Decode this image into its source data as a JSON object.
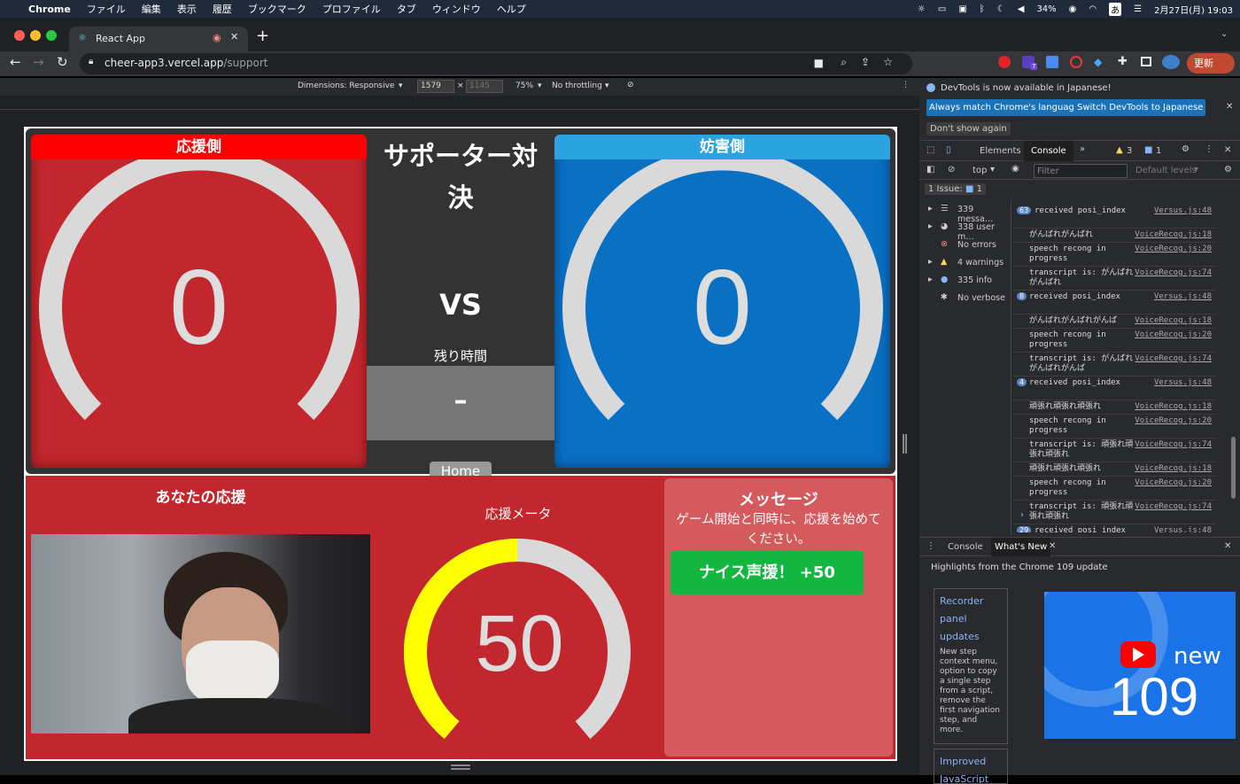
{
  "mac_menu": {
    "app": "Chrome",
    "items": [
      "ファイル",
      "編集",
      "表示",
      "履歴",
      "ブックマーク",
      "プロファイル",
      "タブ",
      "ウィンドウ",
      "ヘルプ"
    ],
    "battery": "34%",
    "ime": "あ",
    "datetime": "2月27日(月) 19:03"
  },
  "browser": {
    "tab_title": "React App",
    "url_host": "cheer-app3.vercel.app",
    "url_path": "/support",
    "update_label": "更新",
    "ext_badge": "7"
  },
  "device_toolbar": {
    "dimensions": "Dimensions: Responsive",
    "width": "1579",
    "height": "1145",
    "zoom": "75%",
    "throttling": "No throttling"
  },
  "page": {
    "cheer_side": "応援側",
    "disrupt_side": "妨害側",
    "title_line1": "サポーター対",
    "title_line2": "決",
    "vs": "VS",
    "remaining_label": "残り時間",
    "remaining_value": "–",
    "cheer_score": "0",
    "disrupt_score": "0",
    "home_button": "Home",
    "your_cheer": "あなたの応援",
    "meter_label": "応援メータ",
    "meter_value": "50",
    "meter_fraction": 0.5,
    "message_title": "メッセージ",
    "message_body": "ゲーム開始と同時に、応援を始めてください。",
    "nice_label": "ナイス声援！ +50",
    "colors": {
      "cheer": "#c1272d",
      "cheer_header": "#ff0000",
      "disrupt": "#0a70c4",
      "disrupt_header": "#2ba3e0",
      "meter_fill": "#ffff00",
      "nice_bg": "#13b63f"
    }
  },
  "devtools": {
    "notice": "DevTools is now available in Japanese!",
    "btn_match": "Always match Chrome's language",
    "btn_switch": "Switch DevTools to Japanese",
    "btn_dont": "Don't show again",
    "tab_elements": "Elements",
    "tab_console": "Console",
    "warn_count": "3",
    "msg_count": "1",
    "context": "top",
    "filter_placeholder": "Filter",
    "levels": "Default levels",
    "issues": "1 Issue:",
    "issues_count": "1",
    "sidebar": [
      {
        "label": "339 messa…",
        "icon": "list-icon"
      },
      {
        "label": "338 user m…",
        "icon": "user-icon"
      },
      {
        "label": "No errors",
        "icon": "error-icon"
      },
      {
        "label": "4 warnings",
        "icon": "warning-icon"
      },
      {
        "label": "335 info",
        "icon": "info-icon"
      },
      {
        "label": "No verbose",
        "icon": "verbose-icon"
      }
    ],
    "logs": [
      {
        "badge": "63",
        "text": "received posi_index",
        "src": "Versus.js:48"
      },
      {
        "badge": "",
        "text": "がんばれがんばれ",
        "src": "VoiceRecog.js:18"
      },
      {
        "badge": "",
        "text": "speech recong in progress",
        "src": "VoiceRecog.js:20"
      },
      {
        "badge": "",
        "text": "transcript is: がんばれがんばれ",
        "src": "VoiceRecog.js:74"
      },
      {
        "badge": "8",
        "text": "received posi_index",
        "src": "Versus.js:48"
      },
      {
        "badge": "",
        "text": "がんばれがんばれがんば",
        "src": "VoiceRecog.js:18"
      },
      {
        "badge": "",
        "text": "speech recong in progress",
        "src": "VoiceRecog.js:20"
      },
      {
        "badge": "",
        "text": "transcript is: がんばれがんばれがんば",
        "src": "VoiceRecog.js:74"
      },
      {
        "badge": "4",
        "text": "received posi_index",
        "src": "Versus.js:48"
      },
      {
        "badge": "",
        "text": "頑張れ頑張れ頑張れ",
        "src": "VoiceRecog.js:18"
      },
      {
        "badge": "",
        "text": "speech recong in progress",
        "src": "VoiceRecog.js:20"
      },
      {
        "badge": "",
        "text": "transcript is: 頑張れ頑張れ頑張れ",
        "src": "VoiceRecog.js:74"
      },
      {
        "badge": "",
        "text": "頑張れ頑張れ頑張れ",
        "src": "VoiceRecog.js:18"
      },
      {
        "badge": "",
        "text": "speech recong in progress",
        "src": "VoiceRecog.js:20"
      },
      {
        "badge": "",
        "text": "transcript is: 頑張れ頑張れ頑張れ",
        "src": "VoiceRecog.js:74"
      },
      {
        "badge": "29",
        "text": "received posi_index",
        "src": "Versus.js:48"
      }
    ],
    "drawer_console": "Console",
    "drawer_whatsnew": "What's New",
    "highlights": "Highlights from the Chrome 109 update",
    "recorder_title": "Recorder panel updates",
    "recorder_body": "New step context menu, option to copy a single step from a script, remove the first navigation step, and more.",
    "improved": "Improved JavaScript",
    "promo_new": "new",
    "promo_ver": "109"
  }
}
